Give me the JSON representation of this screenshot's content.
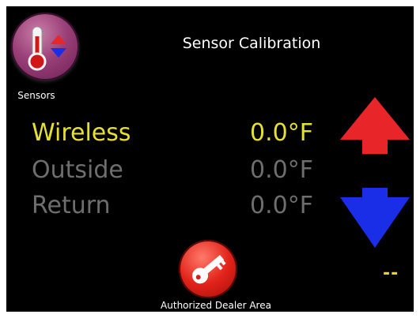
{
  "header": {
    "title": "Sensor Calibration",
    "sensors_label": "Sensors",
    "sensors_icon": "thermometer-icon"
  },
  "sensors": [
    {
      "name": "Wireless",
      "value": "0.0",
      "unit": "°F",
      "state": "selected"
    },
    {
      "name": "Outside",
      "value": "0.0",
      "unit": "°F",
      "state": "unselected"
    },
    {
      "name": "Return",
      "value": "0.0",
      "unit": "°F",
      "state": "unselected"
    }
  ],
  "controls": {
    "up_icon": "arrow-up-icon",
    "down_icon": "arrow-down-icon",
    "offset_display": "--"
  },
  "footer": {
    "dealer_label": "Authorized Dealer Area",
    "dealer_icon": "key-icon"
  },
  "colors": {
    "background": "#000000",
    "selected_text": "#e6e033",
    "unselected_text": "#6e6e6e",
    "up_arrow": "#e8262a",
    "down_arrow": "#1a2ee8",
    "offset_text": "#f0d21a"
  }
}
